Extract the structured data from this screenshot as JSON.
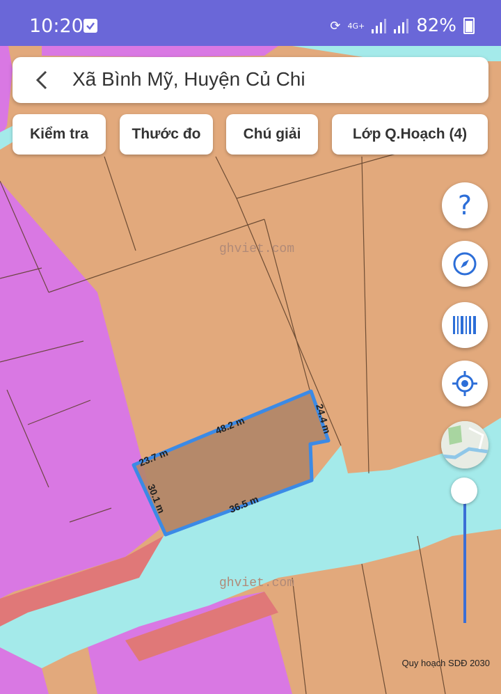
{
  "status": {
    "time": "10:20",
    "network": "4G+",
    "battery": "82%"
  },
  "search": {
    "title": "Xã Bình Mỹ, Huyện Củ Chi"
  },
  "toolbar": {
    "check": "Kiểm tra",
    "measure": "Thước đo",
    "legend": "Chú giải",
    "layers": "Lớp Q.Hoạch (4)"
  },
  "map": {
    "watermark": "ghviet.com",
    "parcel_edges": [
      "48.2 m",
      "24.4 m",
      "23.7 m",
      "30.1 m",
      "36.5 m"
    ],
    "attribution": "Quy hoạch SDĐ 2030",
    "colors": {
      "residential": "#e2a97c",
      "water": "#a4eaea",
      "commercial": "#d978e3",
      "road": "#e07878",
      "selection": "#3b8ae6"
    }
  },
  "controls": {
    "help_icon": "question-icon",
    "compass_icon": "compass-icon",
    "barcode_icon": "barcode-icon",
    "locate_icon": "crosshair-icon",
    "zoom_level": 0.95
  }
}
